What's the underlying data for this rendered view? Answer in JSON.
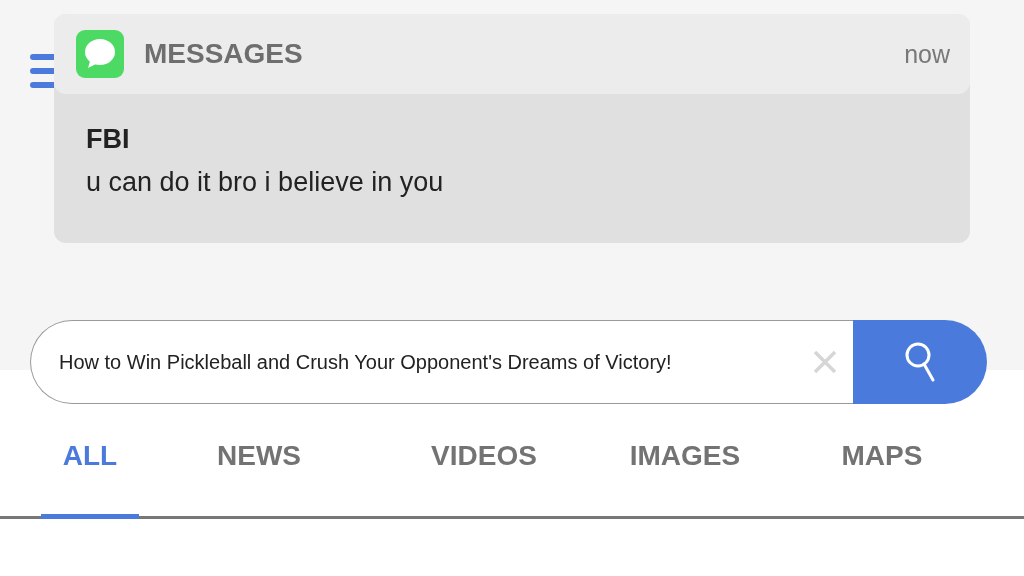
{
  "notification": {
    "app": "MESSAGES",
    "time": "now",
    "sender": "FBI",
    "message": "u can do it bro i believe in you"
  },
  "search": {
    "value": "How to Win Pickleball and Crush Your Opponent's Dreams of Victory!"
  },
  "tabs": [
    {
      "label": "ALL",
      "selected": true
    },
    {
      "label": "NEWS",
      "selected": false
    },
    {
      "label": "VIDEOS",
      "selected": false
    },
    {
      "label": "IMAGES",
      "selected": false
    },
    {
      "label": "MAPS",
      "selected": false
    }
  ]
}
